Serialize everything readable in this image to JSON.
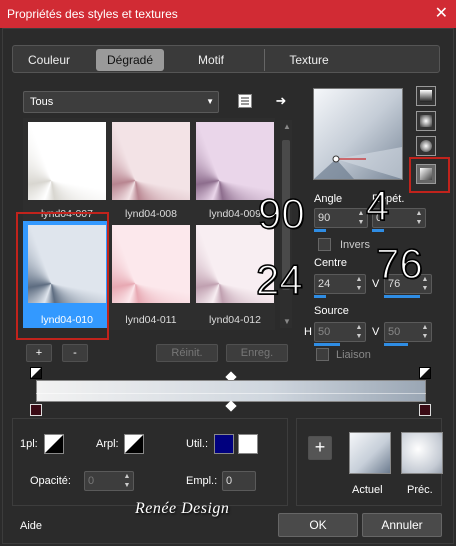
{
  "window": {
    "title": "Propriétés des styles et textures",
    "close_icon": "close-icon"
  },
  "tabs": [
    {
      "label": "Couleur",
      "selected": false
    },
    {
      "label": "Dégradé",
      "selected": true
    },
    {
      "label": "Motif",
      "selected": false
    },
    {
      "label": "Texture",
      "selected": false
    }
  ],
  "category": {
    "selected": "Tous"
  },
  "thumbnails": [
    {
      "label": "lynd04-007",
      "colors": [
        "#ffffff",
        "#d8d6d0"
      ]
    },
    {
      "label": "lynd04-008",
      "colors": [
        "#f3e3e6",
        "#b88590"
      ]
    },
    {
      "label": "lynd04-009",
      "colors": [
        "#ead6ea",
        "#8d6d8d"
      ]
    },
    {
      "label": "lynd04-010",
      "colors": [
        "#dfe5ed",
        "#5d6c80"
      ],
      "selected": true
    },
    {
      "label": "lynd04-011",
      "colors": [
        "#fce8ec",
        "#e7a8b2"
      ]
    },
    {
      "label": "lynd04-012",
      "colors": [
        "#f8eef2",
        "#c0a0b0"
      ]
    }
  ],
  "list_buttons": {
    "add": "+",
    "remove": "-",
    "reset": "Réinit.",
    "save": "Enreg."
  },
  "angle": {
    "label": "Angle",
    "value": "90",
    "annotation": "90"
  },
  "repeats": {
    "label": "Répét.",
    "value": "0",
    "annotation": "4"
  },
  "invert": {
    "label": "Invers",
    "checked": false
  },
  "centre": {
    "label": "Centre",
    "h": "24",
    "v": "76",
    "annotation_h": "24",
    "annotation_v": "76",
    "v_label": "V"
  },
  "source": {
    "label": "Source",
    "h_label": "H",
    "h": "50",
    "v_label": "V",
    "v": "50"
  },
  "link": {
    "label": "Liaison",
    "checked": false
  },
  "bottom": {
    "pl_label": "1pl:",
    "arpl_label": "Arpl:",
    "util_label": "Util.:",
    "util_colors": [
      "#00007e",
      "#ffffff"
    ],
    "opacity_label": "Opacité:",
    "opacity_value": "0",
    "empl_label": "Empl.:",
    "empl_value": "0"
  },
  "preview_labels": {
    "current": "Actuel",
    "previous": "Préc."
  },
  "footer": {
    "help": "Aide",
    "ok": "OK",
    "cancel": "Annuler",
    "watermark": "Renée Design"
  }
}
